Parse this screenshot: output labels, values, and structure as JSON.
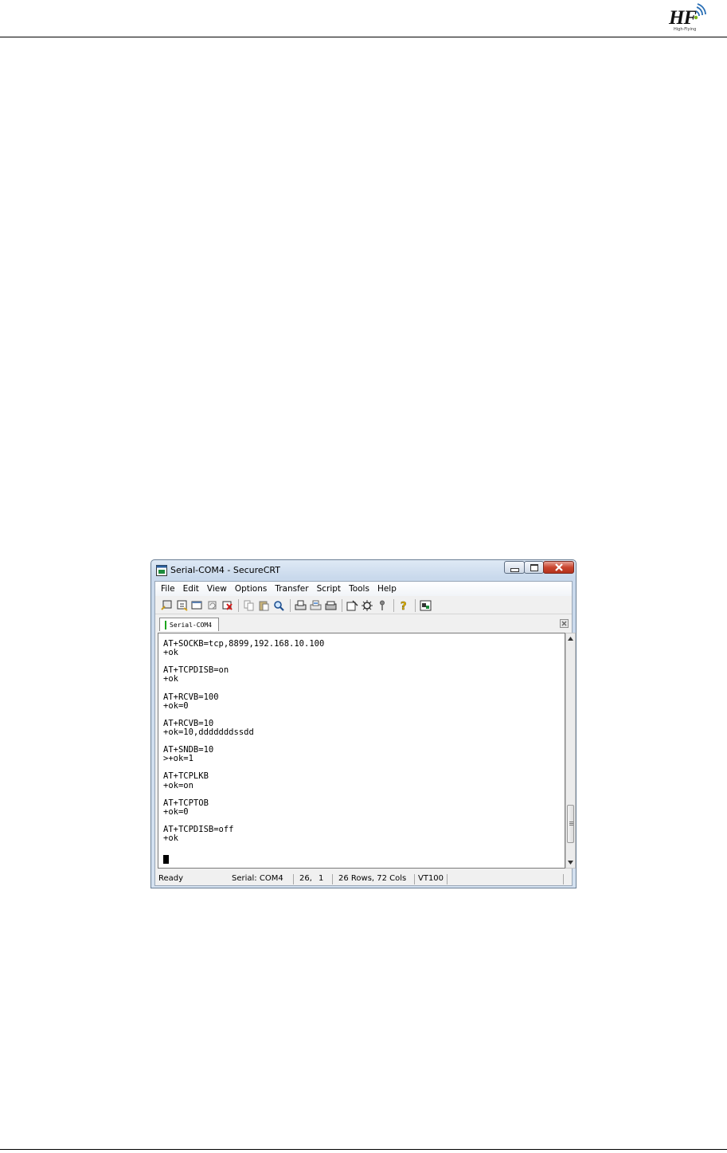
{
  "logo": {
    "mark": "HF",
    "subtitle": "High-Flying"
  },
  "window": {
    "title": "Serial-COM4 - SecureCRT",
    "menu": [
      "File",
      "Edit",
      "View",
      "Options",
      "Transfer",
      "Script",
      "Tools",
      "Help"
    ],
    "toolbar_icons": [
      "connect-icon",
      "quick-connect-icon",
      "connect-tab-icon",
      "reconnect-icon",
      "disconnect-icon",
      "copy-icon",
      "paste-icon",
      "find-icon",
      "print-icon",
      "print-selection-icon",
      "print-setup-icon",
      "session-options-icon",
      "global-options-icon",
      "key-icon",
      "help-icon",
      "about-icon"
    ],
    "tab": {
      "label": "Serial-COM4"
    },
    "terminal_lines": [
      "AT+SOCKB=tcp,8899,192.168.10.100",
      "+ok",
      "",
      "AT+TCPDISB=on",
      "+ok",
      "",
      "AT+RCVB=100",
      "+ok=0",
      "",
      "AT+RCVB=10",
      "+ok=10,dddddddssdd",
      "",
      "AT+SNDB=10",
      ">+ok=1",
      "",
      "AT+TCPLKB",
      "+ok=on",
      "",
      "AT+TCPTOB",
      "+ok=0",
      "",
      "AT+TCPDISB=off",
      "+ok"
    ],
    "status": {
      "state": "Ready",
      "connection": "Serial: COM4",
      "row": "26,",
      "col": "1",
      "size": "26 Rows,  72 Cols",
      "emulation": "VT100"
    },
    "scroll_position": 0.92
  }
}
